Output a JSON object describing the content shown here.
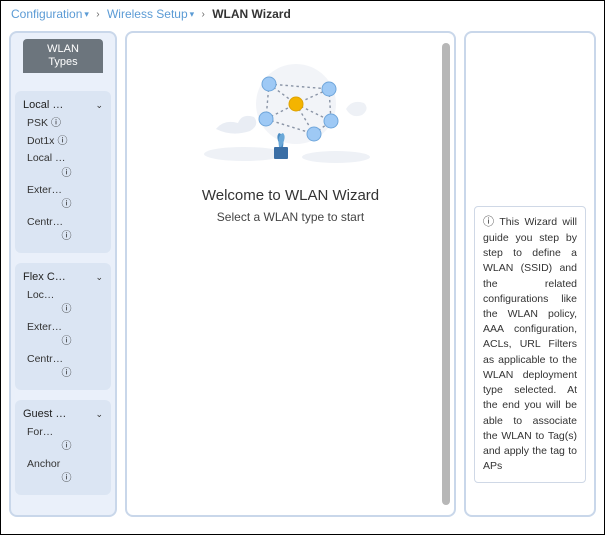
{
  "breadcrumb": {
    "item1": "Configuration",
    "item2": "Wireless Setup",
    "current": "WLAN Wizard"
  },
  "sidebar": {
    "tab_line1": "WLAN",
    "tab_line2": "Types",
    "groups": [
      {
        "title": "Local …",
        "items": [
          {
            "label": "PSK"
          },
          {
            "label": "Dot1x"
          },
          {
            "label": "Local …"
          },
          {
            "label": "Exter…"
          },
          {
            "label": "Centr…"
          }
        ]
      },
      {
        "title": "Flex C…",
        "items": [
          {
            "label": "Loc…"
          },
          {
            "label": "Exter…"
          },
          {
            "label": "Centr…"
          }
        ]
      },
      {
        "title": "Guest …",
        "items": [
          {
            "label": "For…"
          },
          {
            "label": "Anchor"
          }
        ]
      }
    ]
  },
  "main": {
    "title": "Welcome to WLAN Wizard",
    "subtitle": "Select a WLAN type to start"
  },
  "info": {
    "text": "This Wizard will guide you step by step to define a WLAN (SSID) and the related configurations like the WLAN policy, AAA configuration, ACLs, URL Filters as applicable to the WLAN deployment type selected. At the end you will be able to associate the WLAN to Tag(s) and apply the tag to APs"
  },
  "icons": {
    "info_glyph": "ℹ"
  }
}
